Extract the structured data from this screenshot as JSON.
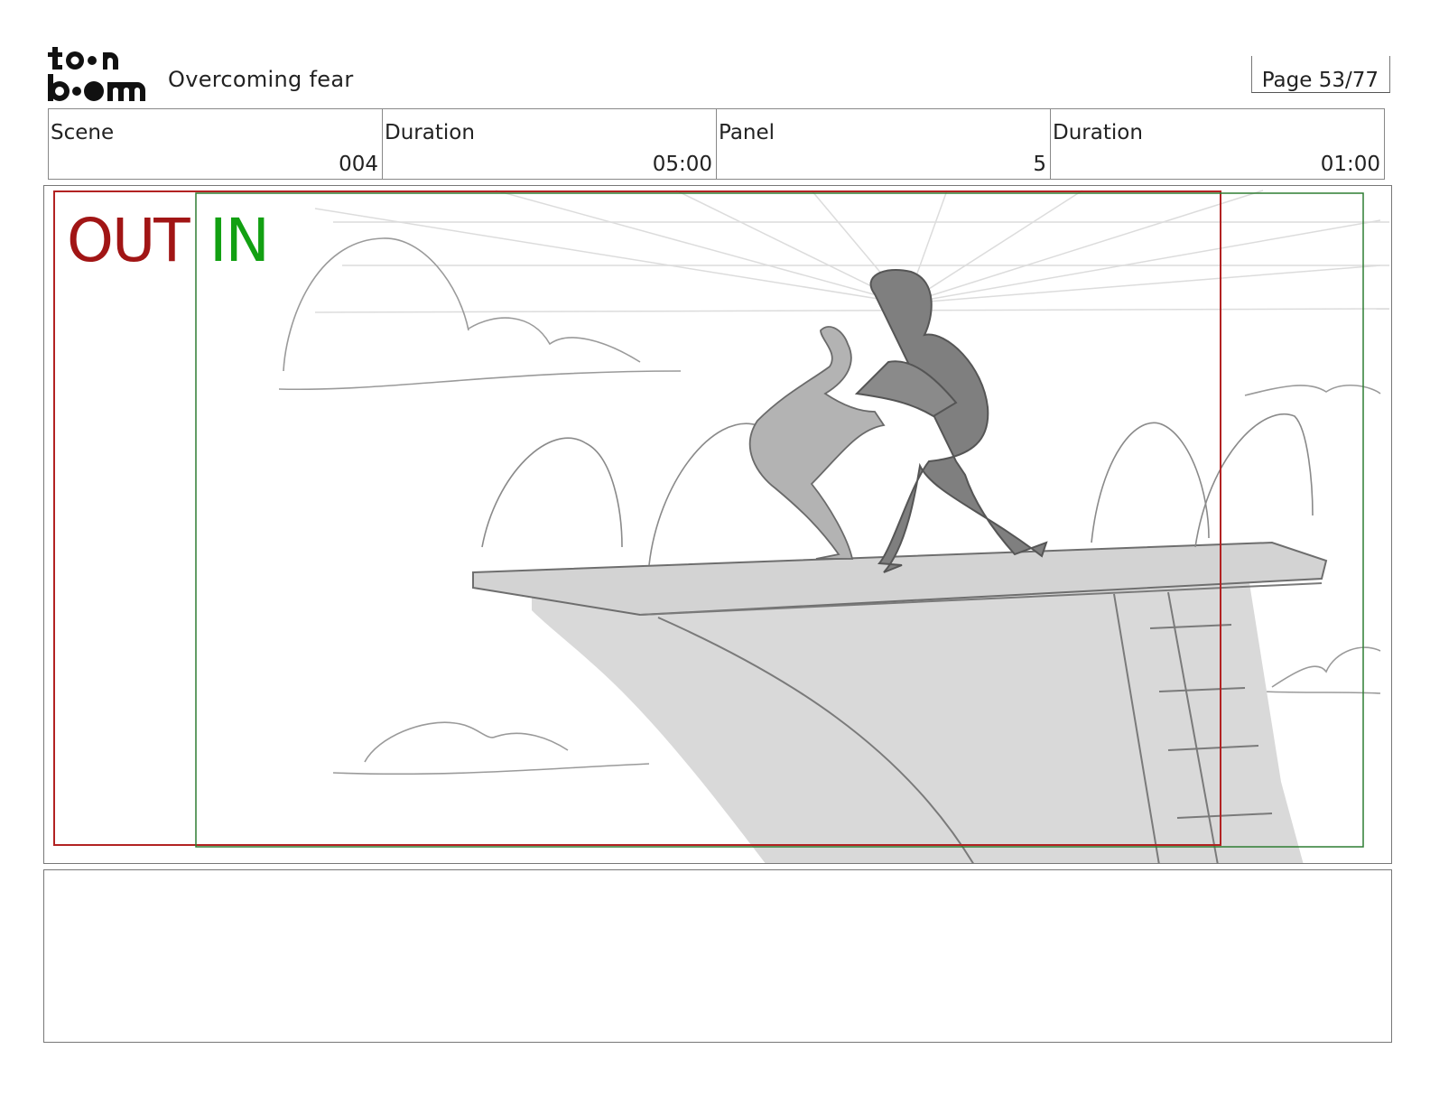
{
  "header": {
    "logo_text": "toon boom",
    "title": "Overcoming fear",
    "page_label": "Page 53/77"
  },
  "info": {
    "scene_label": "Scene",
    "scene_value": "004",
    "scene_duration_label": "Duration",
    "scene_duration_value": "05:00",
    "panel_label": "Panel",
    "panel_value": "5",
    "panel_duration_label": "Duration",
    "panel_duration_value": "01:00"
  },
  "panel": {
    "out_label": "OUT",
    "in_label": "IN",
    "out_color": "#a11515",
    "in_color": "#12a012"
  },
  "notes": {}
}
